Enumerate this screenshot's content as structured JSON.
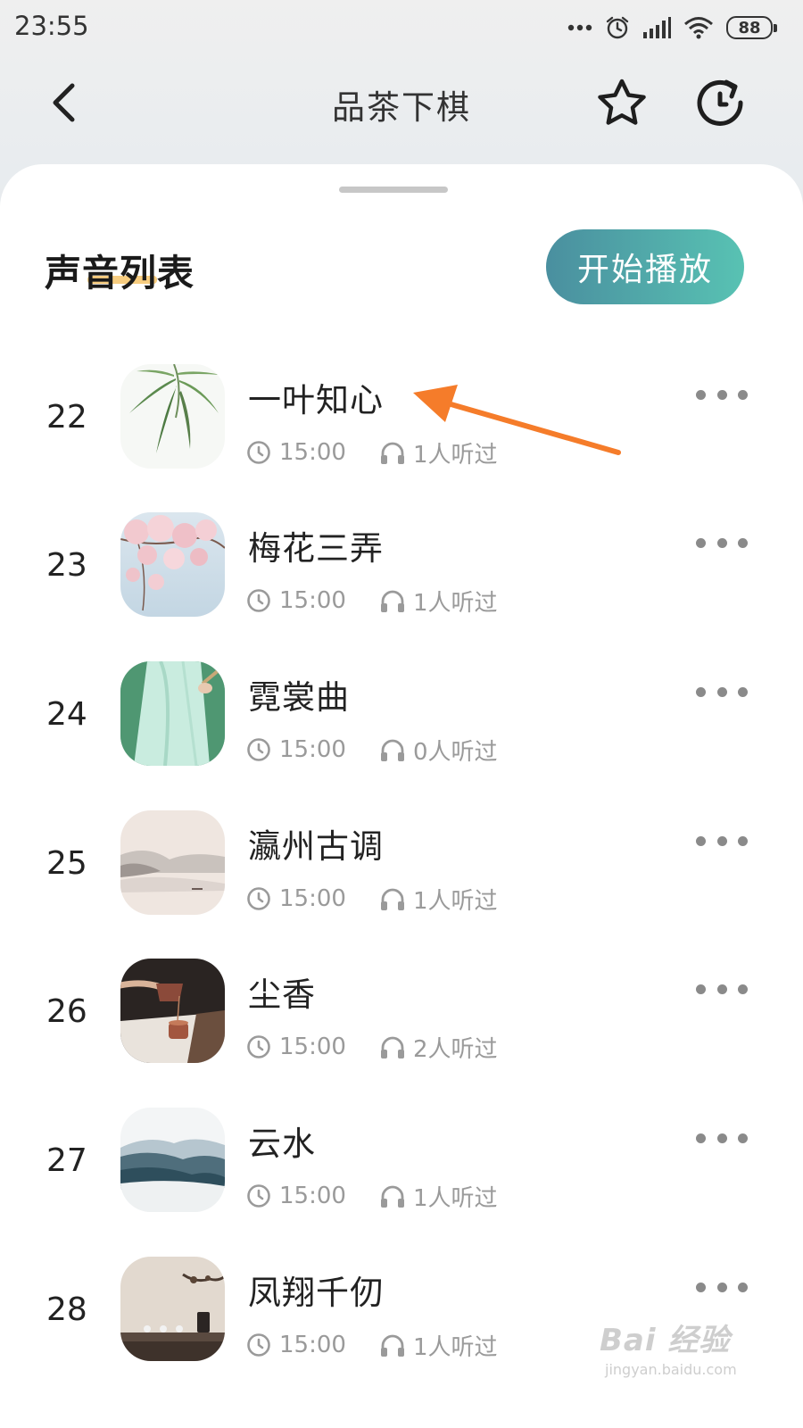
{
  "status_bar": {
    "time": "23:55",
    "battery": "88",
    "icons": [
      "dots-icon",
      "alarm-icon",
      "signal-icon",
      "wifi-icon",
      "battery-icon"
    ]
  },
  "header": {
    "title": "品茶下棋",
    "back_icon": "chevron-left-icon",
    "favorite_icon": "star-icon",
    "refresh_icon": "refresh-icon"
  },
  "sheet": {
    "section_title": "声音列表",
    "play_all_label": "开始播放",
    "accent_gradient": [
      "#4a8f9f",
      "#58c2b3"
    ],
    "underline_color": "#f6c46a"
  },
  "tracks": [
    {
      "index": "22",
      "title": "一叶知心",
      "duration": "15:00",
      "listeners": "1人听过",
      "cover": "bamboo"
    },
    {
      "index": "23",
      "title": "梅花三弄",
      "duration": "15:00",
      "listeners": "1人听过",
      "cover": "plum-blossom"
    },
    {
      "index": "24",
      "title": "霓裳曲",
      "duration": "15:00",
      "listeners": "0人听过",
      "cover": "hanfu-figure"
    },
    {
      "index": "25",
      "title": "瀛州古调",
      "duration": "15:00",
      "listeners": "1人听过",
      "cover": "misty-landscape"
    },
    {
      "index": "26",
      "title": "尘香",
      "duration": "15:00",
      "listeners": "2人听过",
      "cover": "tea-pouring"
    },
    {
      "index": "27",
      "title": "云水",
      "duration": "15:00",
      "listeners": "1人听过",
      "cover": "cloud-mountains"
    },
    {
      "index": "28",
      "title": "凤翔千仞",
      "duration": "15:00",
      "listeners": "1人听过",
      "cover": "tea-table"
    }
  ],
  "annotation": {
    "arrow_color": "#f57c2a"
  },
  "watermark": {
    "brand": "Bai  经验",
    "url": "jingyan.baidu.com"
  }
}
